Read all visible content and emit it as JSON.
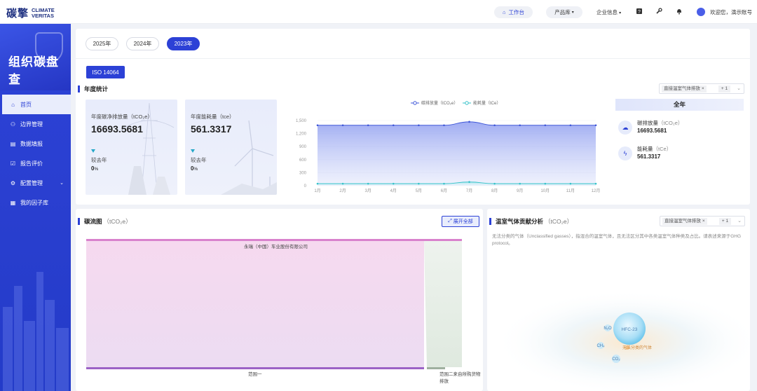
{
  "brand": {
    "cn": "碳擎",
    "en": "CLIMATE VERITAS"
  },
  "topbar": {
    "workbench": "工作台",
    "products": "产品库",
    "enterprise": "企业信息",
    "welcome": "欢迎您，演示账号"
  },
  "sidebar": {
    "title": "组织碳盘查",
    "items": [
      {
        "label": "首页",
        "icon": "home-icon"
      },
      {
        "label": "边界管理",
        "icon": "org-icon"
      },
      {
        "label": "数据填报",
        "icon": "database-icon"
      },
      {
        "label": "报告评价",
        "icon": "report-icon"
      },
      {
        "label": "配置管理",
        "icon": "config-icon"
      },
      {
        "label": "我的因子库",
        "icon": "library-icon"
      }
    ]
  },
  "years": [
    "2025年",
    "2024年",
    "2023年"
  ],
  "selected_year": "2023年",
  "standard_tab": "ISO 14064",
  "annual": {
    "title": "年度统计",
    "filter_tag": "直接温室气体排放",
    "filter_more": "+ 1",
    "emission": {
      "label": "年度碳净排放量（tCO₂e）",
      "value": "16693.5681",
      "compare_label": "较去年",
      "pct": "0",
      "pct_unit": "%"
    },
    "energy": {
      "label": "年度能耗量（tce）",
      "value": "561.3317",
      "compare_label": "较去年",
      "pct": "0",
      "pct_unit": "%"
    },
    "totals_header": "全年",
    "total_emission_label": "碳排放量",
    "total_emission_unit": "（tCO₂e）",
    "total_emission_value": "16693.5681",
    "total_energy_label": "能耗量",
    "total_energy_unit": "（tCe）",
    "total_energy_value": "561.3317"
  },
  "chart_data": {
    "type": "area",
    "categories": [
      "1月",
      "2月",
      "3月",
      "4月",
      "5月",
      "6月",
      "7月",
      "8月",
      "9月",
      "10月",
      "11月",
      "12月"
    ],
    "series": [
      {
        "name": "碳排放量（tCO₂e）",
        "values": [
          1391,
          1391,
          1391,
          1391,
          1391,
          1391,
          1470,
          1391,
          1391,
          1391,
          1391,
          1391
        ],
        "color": "#3f57d8"
      },
      {
        "name": "能耗量（tCe）",
        "values": [
          46,
          46,
          46,
          46,
          46,
          46,
          85,
          46,
          46,
          46,
          46,
          46
        ],
        "color": "#36c2c9"
      }
    ],
    "yticks": [
      "0",
      "300",
      "600",
      "900",
      "1,200",
      "1,500"
    ],
    "ylim": [
      0,
      1500
    ],
    "legend": "top"
  },
  "sankey": {
    "title": "碳流图",
    "unit": "（tCO₂e）",
    "expand_label": "展开全部",
    "top_node": "永瑞（中国）车业股份有限公司",
    "node_left": "范围一",
    "node_right": "范围二来自所购货物排放"
  },
  "ghg": {
    "title": "温室气体贡献分析",
    "unit": "（tCO₂e）",
    "filter_tag": "直接温室气体排放",
    "filter_more": "+ 1",
    "note": "无法分类的气体（Unclassified gasses），指混合的温室气体，且无法区分其中各类温室气体种类及占比。请表述来源于GHG protocol。",
    "bubbles": [
      "HFC-23",
      "N₂O",
      "CH₄",
      "CO₂",
      "无法分类的气体"
    ]
  },
  "colors": {
    "accent": "#2c41d6",
    "sidebar": "#2c43d8",
    "emission": "#3f57d8",
    "energy": "#36c2c9"
  }
}
